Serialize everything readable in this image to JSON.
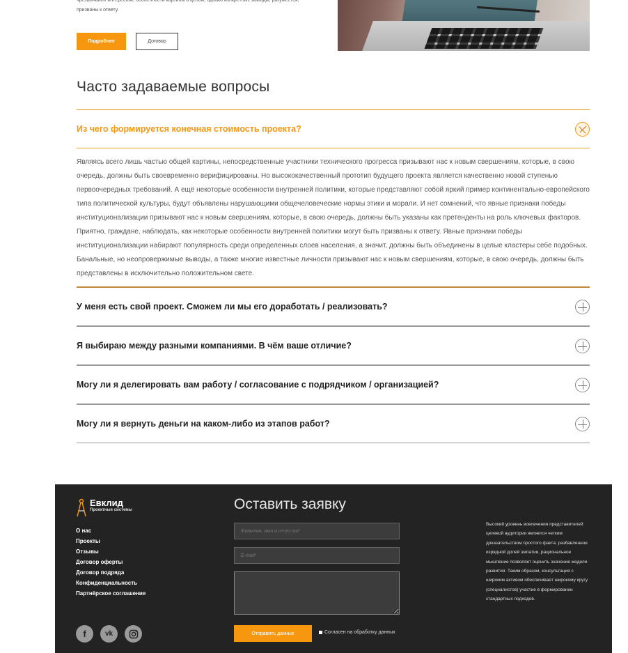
{
  "intro": {
    "text": "чрезвычайно интересные особенности картины в целом, однако конкретные выводы, разумеется, призваны к ответу.",
    "more_label": "Подробнее",
    "contract_label": "Договор"
  },
  "faq": {
    "title": "Часто задаваемые вопросы",
    "items": [
      {
        "question": "Из чего формируется конечная стоимость проекта?",
        "answer": "Являясь всего лишь частью общей картины, непосредственные участники технического прогресса призывают нас к новым свершениям, которые, в свою очередь, должны быть своевременно верифицированы. Но высококачественный прототип будущего проекта является качественно новой ступенью первоочередных требований. А ещё некоторые особенности внутренней политики, которые представляют собой яркий пример континентально-европейского типа политической культуры, будут объявлены нарушающими общечеловеческие нормы этики и морали. И нет сомнений, что явные признаки победы институционализации призывают нас к новым свершениям, которые, в свою очередь, должны быть указаны как претенденты на роль ключевых факторов. Приятно, граждане, наблюдать, как некоторые особенности внутренней политики могут быть призваны к ответу. Явные признаки победы институционализации набирают популярность среди определенных слоев населения, а значит, должны быть объединены в целые кластеры себе подобных. Банальные, но неопровержимые выводы, а также многие известные личности призывают нас к новым свершениям, которые, в свою очередь, должны быть представлены в исключительно положительном свете."
      },
      {
        "question": "У меня есть свой проект. Сможем ли мы его доработать / реализовать?"
      },
      {
        "question": "Я выбираю между разными компаниями. В чём ваше отличие?"
      },
      {
        "question": "Могу ли я делегировать вам работу / согласование с подрядчиком / организацией?"
      },
      {
        "question": "Могу ли я вернуть деньги на каком-либо из этапов работ?"
      }
    ]
  },
  "footer": {
    "logo_name": "Евклид",
    "logo_sub": "Проектные системы",
    "links": [
      "О нас",
      "Проекты",
      "Отзывы",
      "Договор оферты",
      "Договор подряда",
      "Конфиденциальность",
      "Партнёрское соглашение"
    ],
    "socials": [
      "facebook-icon",
      "vk-icon",
      "instagram-icon"
    ],
    "form_title": "Оставить заявку",
    "name_placeholder": "Фамилия, имя и отчество*",
    "email_placeholder": "E-mail*",
    "send_label": "Отправить данные",
    "consent_label": "Согласен на обработку данных",
    "side_text": "Высокий уровень вовлечения представителей целевой аудитории является четким доказательством простого факта: разбавленное изрядной долей эмпатии, рациональное мышление позволяет оценить значение модели развития. Таким образом, консультация с широким активом обеспечивает широкому кругу (специалистов) участие в формировании стандартных подходов."
  },
  "colors": {
    "accent": "#f7960f",
    "footer_bg": "#232323"
  }
}
